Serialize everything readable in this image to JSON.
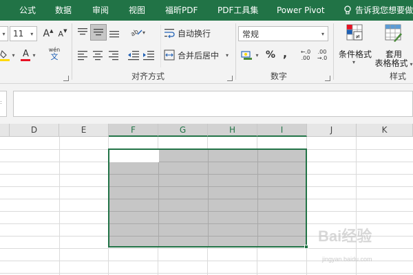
{
  "tabs": [
    "公式",
    "数据",
    "审阅",
    "视图",
    "福昕PDF",
    "PDF工具集",
    "Power Pivot"
  ],
  "tell_me": "告诉我您想要做",
  "colors": {
    "accent": "#217346",
    "selection_fill": "#c6c6c6",
    "font_color_red": "#e81123",
    "highlight_yellow": "#ffd800"
  },
  "font": {
    "size": "11",
    "grow_label": "A",
    "shrink_label": "A",
    "color_label": "A",
    "pinyin_label": "wén"
  },
  "alignment": {
    "group_label": "对齐方式",
    "wrap_text": "自动换行",
    "merge_center": "合并后居中"
  },
  "number": {
    "group_label": "数字",
    "format_value": "常规",
    "percent": "%",
    "comma": ",",
    "increase_decimal": "←.0 .00",
    "decrease_decimal": ".00 →.0"
  },
  "styles": {
    "group_label": "样式",
    "conditional_formatting": "条件格式",
    "format_as_table_line1": "套用",
    "format_as_table_line2": "表格格式"
  },
  "columns": [
    "D",
    "E",
    "F",
    "G",
    "H",
    "I",
    "J",
    "K"
  ],
  "watermark": {
    "main": "Bai经验",
    "sub": "jingyan.baidu.com"
  }
}
